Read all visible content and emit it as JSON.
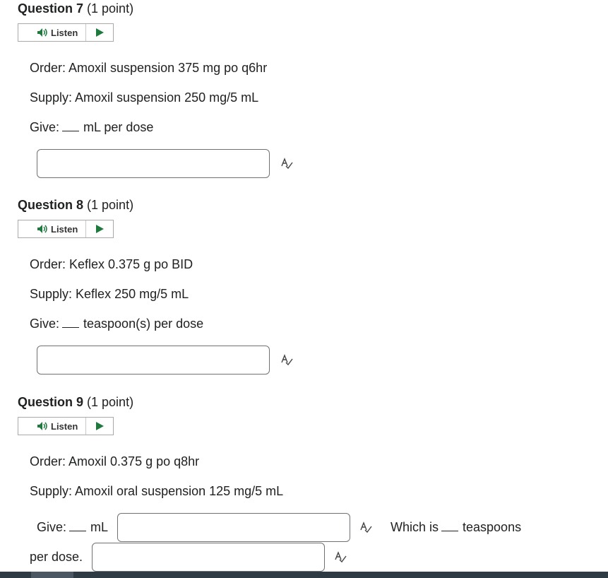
{
  "questions": [
    {
      "title": "Question 7",
      "points": "(1 point)",
      "listen_label": "Listen",
      "order": "Order: Amoxil suspension 375 mg po q6hr",
      "supply": "Supply: Amoxil suspension 250 mg/5 mL",
      "give_prefix": "Give:",
      "give_suffix": "mL per dose",
      "answer": ""
    },
    {
      "title": "Question 8",
      "points": "(1 point)",
      "listen_label": "Listen",
      "order": "Order: Keflex 0.375 g po BID",
      "supply": "Supply: Keflex 250 mg/5 mL",
      "give_prefix": "Give:",
      "give_suffix": "teaspoon(s) per dose",
      "answer": ""
    },
    {
      "title": "Question 9",
      "points": "(1 point)",
      "listen_label": "Listen",
      "order": "Order: Amoxil 0.375 g po q8hr",
      "supply": "Supply: Amoxil oral suspension 125 mg/5 mL",
      "give_prefix": "Give:",
      "give_unit": "mL",
      "which_is": "Which is",
      "teaspoons": "teaspoons",
      "per_dose": "per dose.",
      "answer_ml": "",
      "answer_tsp": ""
    }
  ],
  "icons": {
    "speaker": "speaker-icon",
    "play": "play-icon",
    "spellcheck": "spellcheck-icon"
  },
  "colors": {
    "play_green": "#1e7a3c",
    "text": "#202122",
    "input_border": "#6f7275",
    "bottom_bar": "#2e3a44"
  }
}
